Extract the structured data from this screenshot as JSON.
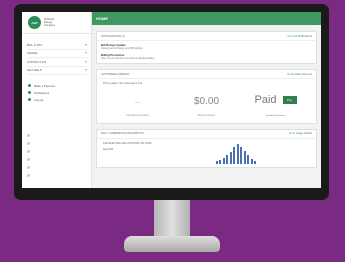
{
  "brand": {
    "logo_mark": "AEP",
    "name": "Fictional Energy Company"
  },
  "sidebar": {
    "nav": [
      {
        "label": "BILL & PAY"
      },
      {
        "label": "USAGE"
      },
      {
        "label": "CONTACT US"
      },
      {
        "label": "GET HELP"
      }
    ],
    "links": [
      {
        "label": "Make a Payment"
      },
      {
        "label": "Notifications"
      },
      {
        "label": "Log out"
      }
    ]
  },
  "header": {
    "title": "HOME"
  },
  "notifications": {
    "title": "NOTIFICATIONS (3)",
    "link": "Go to all Notifications",
    "items": [
      {
        "title": "Bill Design Update",
        "text": "Viewing new bill design and PDF options"
      },
      {
        "title": "Billing Promotion",
        "text": "Save on your bill when you enroll in paperless billing"
      }
    ]
  },
  "account": {
    "title": "CUSTOMER COMPANY",
    "link": "Go To Make Payment",
    "subtitle": "This is paper, the Consumer's info",
    "due_placeholder": "---",
    "amount": "$0.00",
    "status": "Paid",
    "pay_button": "Pay",
    "labels": {
      "last_payment": "Last Payment Amount",
      "pay_due": "Pay Due Amount",
      "autopay": "Scheduled Payment"
    }
  },
  "usage": {
    "title": "DAILY COMPARISON (KILOWATTS)",
    "link": "Go to Usage Details",
    "address": "1234 ELECTRIC AVE, ANYTOWN, OH 12345",
    "date_label": "Sep 2023",
    "bar_levels": [
      0.12,
      0.18,
      0.28,
      0.42,
      0.58,
      0.82,
      1.0,
      0.86,
      0.66,
      0.44,
      0.26,
      0.14
    ],
    "bar_color": "#4a6fb5"
  },
  "colors": {
    "brand_green": "#3f9762",
    "background": "#7a2a83"
  }
}
